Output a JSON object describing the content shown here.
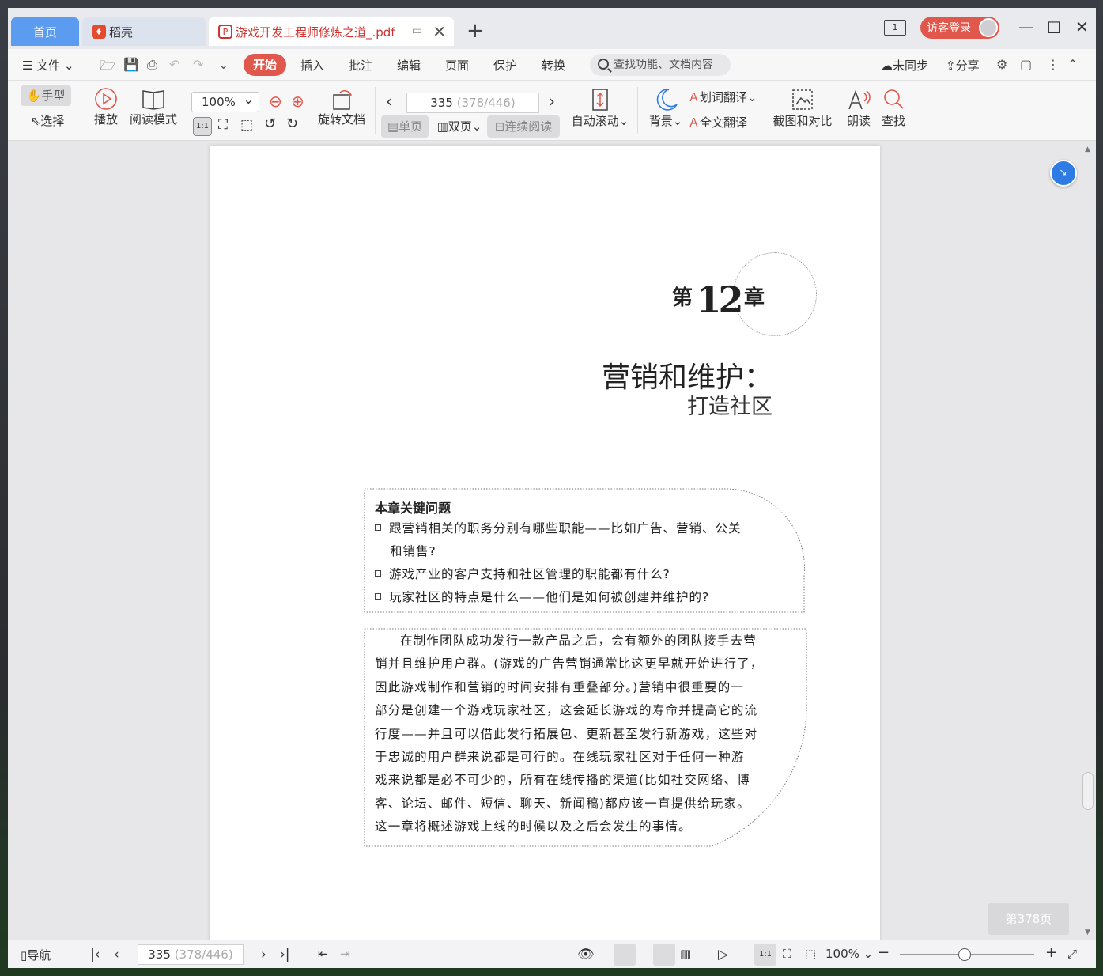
{
  "titlebar": {
    "tabs": [
      {
        "label": "首页"
      },
      {
        "label": "稻壳"
      },
      {
        "label": "游戏开发工程师修炼之道_.pdf"
      }
    ],
    "page_icon_label": "1",
    "login_label": "访客登录"
  },
  "menubar": {
    "file_label": "文件",
    "tabs": [
      "开始",
      "插入",
      "批注",
      "编辑",
      "页面",
      "保护",
      "转换"
    ],
    "search_placeholder": "查找功能、文档内容",
    "sync_label": "未同步",
    "share_label": "分享"
  },
  "ribbon": {
    "hand_label": "手型",
    "select_label": "选择",
    "play_label": "播放",
    "read_mode_label": "阅读模式",
    "zoom_value": "100%",
    "actual_size_label": "1:1",
    "rotate_label": "旋转文档",
    "page_current": "335",
    "page_total": "(378/446)",
    "single_label": "单页",
    "double_label": "双页",
    "continuous_label": "连续阅读",
    "autoscroll_label": "自动滚动",
    "background_label": "背景",
    "word_translate_label": "划词翻译",
    "full_translate_label": "全文翻译",
    "screenshot_label": "截图和对比",
    "read_aloud_label": "朗读",
    "find_label": "查找"
  },
  "document": {
    "chapter_prefix": "第",
    "chapter_number": "12",
    "chapter_suffix": "章",
    "title_line1": "营销和维护：",
    "title_line2": "打造社区",
    "key_questions_title": "本章关键问题",
    "key_questions": [
      "跟营销相关的职务分别有哪些职能——比如广告、营销、公关",
      "和销售?",
      "游戏产业的客户支持和社区管理的职能都有什么?",
      "玩家社区的特点是什么——他们是如何被创建并维护的?"
    ],
    "body_lines": [
      "在制作团队成功发行一款产品之后，会有额外的团队接手去营",
      "销并且维护用户群。(游戏的广告营销通常比这更早就开始进行了，",
      "因此游戏制作和营销的时间安排有重叠部分。)营销中很重要的一",
      "部分是创建一个游戏玩家社区，这会延长游戏的寿命并提高它的流",
      "行度——并且可以借此发行拓展包、更新甚至发行新游戏，这些对",
      "于忠诚的用户群来说都是可行的。在线玩家社区对于任何一种游",
      "戏来说都是必不可少的，所有在线传播的渠道(比如社交网络、博",
      "客、论坛、邮件、短信、聊天、新闻稿)都应该一直提供给玩家。",
      "这一章将概述游戏上线的时候以及之后会发生的事情。"
    ],
    "page_badge": "第378页"
  },
  "statusbar": {
    "nav_label": "导航",
    "page_current": "335",
    "page_total": "(378/446)",
    "zoom_value": "100%",
    "actual_size_label": "1:1"
  },
  "colors": {
    "accent_red": "#e2574c",
    "tab_blue": "#5b9cf0",
    "float_blue": "#2f7be6"
  }
}
